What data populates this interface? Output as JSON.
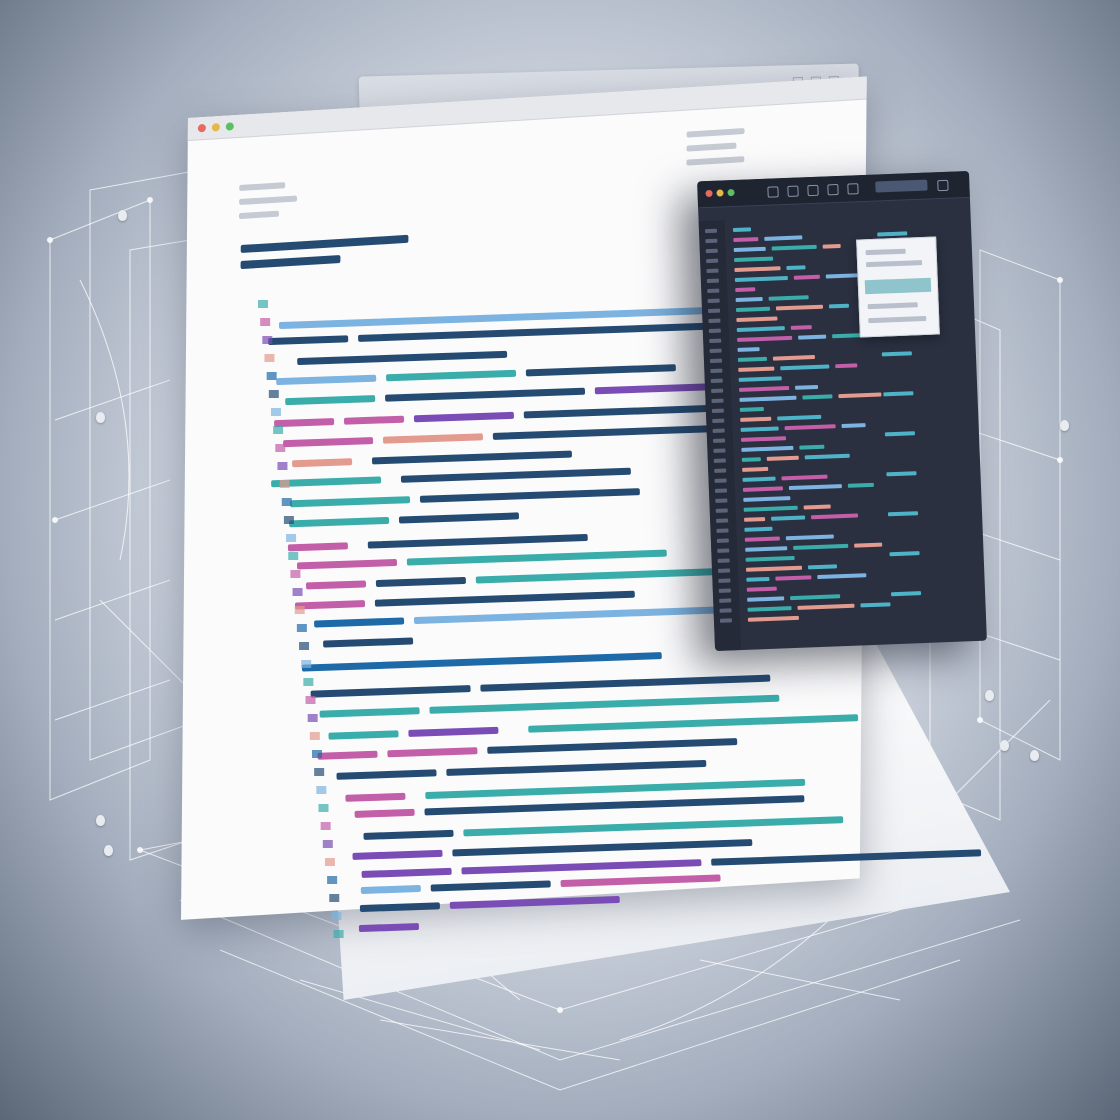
{
  "scene": {
    "description_role": "illustration",
    "colors": {
      "background_center": "#f4f6f9",
      "background_edge": "#5c6778",
      "wire": "#ffffff",
      "paper": "#fbfbfc",
      "editor_bg": "#2a3040",
      "code_navy": "#254b73",
      "code_blue": "#7cb3e0",
      "code_teal": "#3aadab",
      "code_pink": "#c35ea8",
      "code_purple": "#7a4cb5",
      "code_salmon": "#e39a8f"
    }
  },
  "document_window": {
    "traffic_lights": [
      "red",
      "yellow",
      "green"
    ],
    "icons": [
      "close-dot",
      "minimize-dot",
      "maximize-dot"
    ]
  },
  "editor_window": {
    "traffic_lights": [
      "red",
      "yellow",
      "green"
    ],
    "toolbar_icons": [
      "file-icon",
      "folder-icon",
      "settings-icon",
      "search-icon",
      "play-icon",
      "gear-icon"
    ]
  },
  "code_palette": [
    "#254b73",
    "#7cb3e0",
    "#3aadab",
    "#c35ea8",
    "#7a4cb5",
    "#e39a8f",
    "#1e6aa8"
  ]
}
